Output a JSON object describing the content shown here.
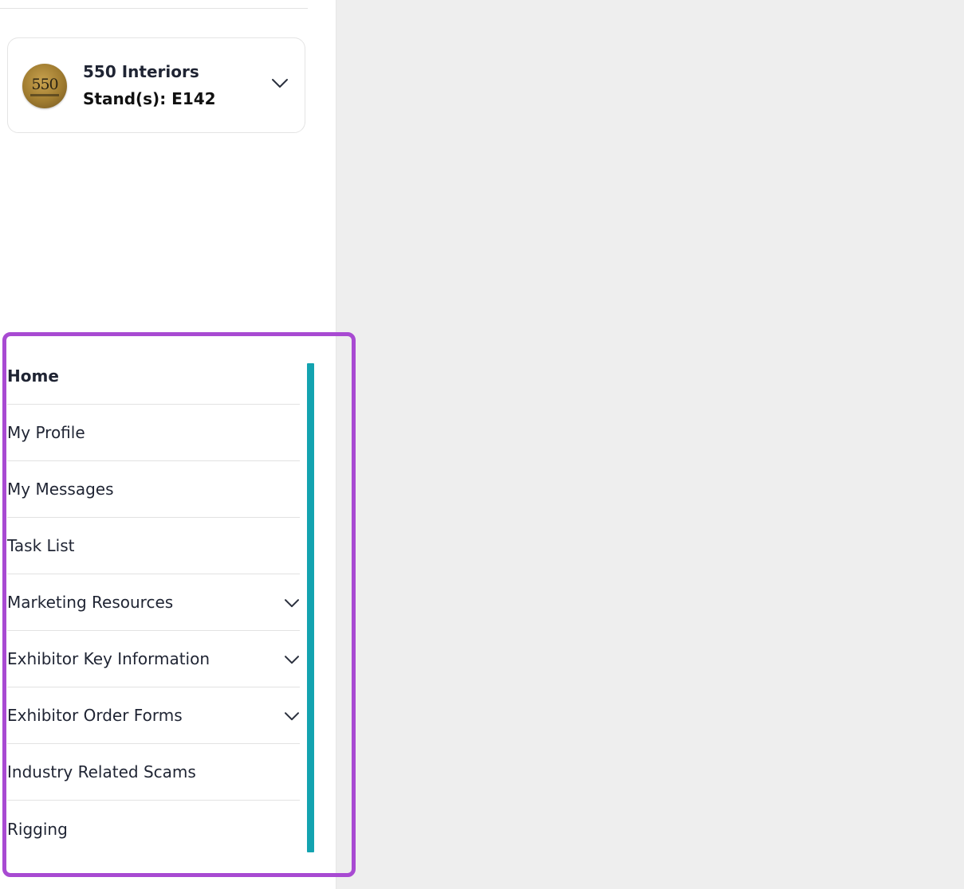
{
  "company": {
    "logo_text": "550",
    "name": "550 Interiors",
    "stand": "Stand(s): E142",
    "expand_icon": "chevron-down-icon"
  },
  "nav": {
    "items": [
      {
        "label": "Home",
        "active": true,
        "has_submenu": false
      },
      {
        "label": "My Profile",
        "active": false,
        "has_submenu": false
      },
      {
        "label": "My Messages",
        "active": false,
        "has_submenu": false
      },
      {
        "label": "Task List",
        "active": false,
        "has_submenu": false
      },
      {
        "label": "Marketing Resources",
        "active": false,
        "has_submenu": true
      },
      {
        "label": "Exhibitor Key Information",
        "active": false,
        "has_submenu": true
      },
      {
        "label": "Exhibitor Order Forms",
        "active": false,
        "has_submenu": true
      },
      {
        "label": "Industry Related Scams",
        "active": false,
        "has_submenu": false
      },
      {
        "label": "Rigging",
        "active": false,
        "has_submenu": false
      }
    ]
  },
  "colors": {
    "scrollbar": "#13a3b0",
    "highlight": "#a84ad2",
    "text": "#1f2433",
    "background": "#eeeeee"
  }
}
